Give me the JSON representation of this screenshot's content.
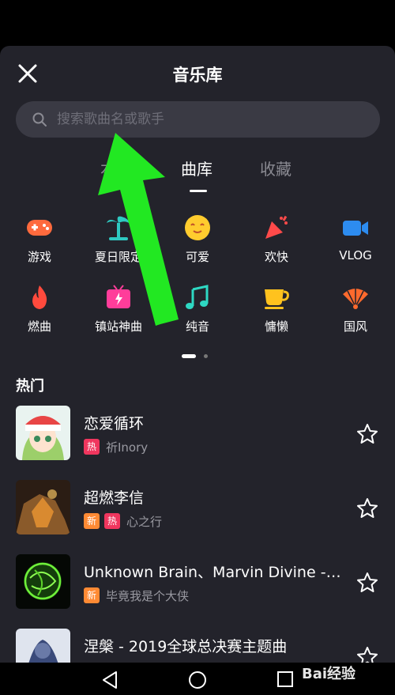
{
  "header": {
    "title": "音乐库"
  },
  "search": {
    "placeholder": "搜索歌曲名或歌手"
  },
  "tabs": [
    {
      "label": "本"
    },
    {
      "label": "曲库"
    },
    {
      "label": "收藏"
    }
  ],
  "categories": [
    {
      "label": "游戏",
      "icon": "gamepad-icon",
      "color": "#ff6a3d"
    },
    {
      "label": "夏日限定",
      "icon": "palm-tree-icon",
      "color": "#2ec9c1"
    },
    {
      "label": "可爱",
      "icon": "smiley-icon",
      "color": "#ffcc2e"
    },
    {
      "label": "欢快",
      "icon": "party-popper-icon",
      "color": "#ff4a4a"
    },
    {
      "label": "VLOG",
      "icon": "video-camera-icon",
      "color": "#2d8cf0"
    },
    {
      "label": "燃曲",
      "icon": "flame-icon",
      "color": "#ff4a3d"
    },
    {
      "label": "镇站神曲",
      "icon": "tv-icon",
      "color": "#ff3d9a"
    },
    {
      "label": "纯音",
      "icon": "music-note-icon",
      "color": "#2ed8c3"
    },
    {
      "label": "慵懒",
      "icon": "coffee-cup-icon",
      "color": "#ffc21e"
    },
    {
      "label": "国风",
      "icon": "fan-icon",
      "color": "#ff6a2d"
    }
  ],
  "section": {
    "hot_title": "热门"
  },
  "songs": [
    {
      "title": "恋爱循环",
      "badges": [
        "热"
      ],
      "artist": "祈Inory"
    },
    {
      "title": "超燃李信",
      "badges": [
        "新",
        "热"
      ],
      "artist": "心之行"
    },
    {
      "title": "Unknown Brain、Marvin Divine - ...",
      "badges": [
        "新"
      ],
      "artist": "毕竟我是个大侠"
    },
    {
      "title": "涅槃 - 2019全球总决赛主题曲",
      "badges": [],
      "artist": ""
    }
  ],
  "watermark": {
    "text": "Bai经验"
  },
  "colors": {
    "sheet_bg": "#23232b",
    "search_bg": "#3a3a44",
    "hot_badge": "#f0365e",
    "new_badge": "#ff8a34",
    "annotation_arrow": "#22e822"
  }
}
